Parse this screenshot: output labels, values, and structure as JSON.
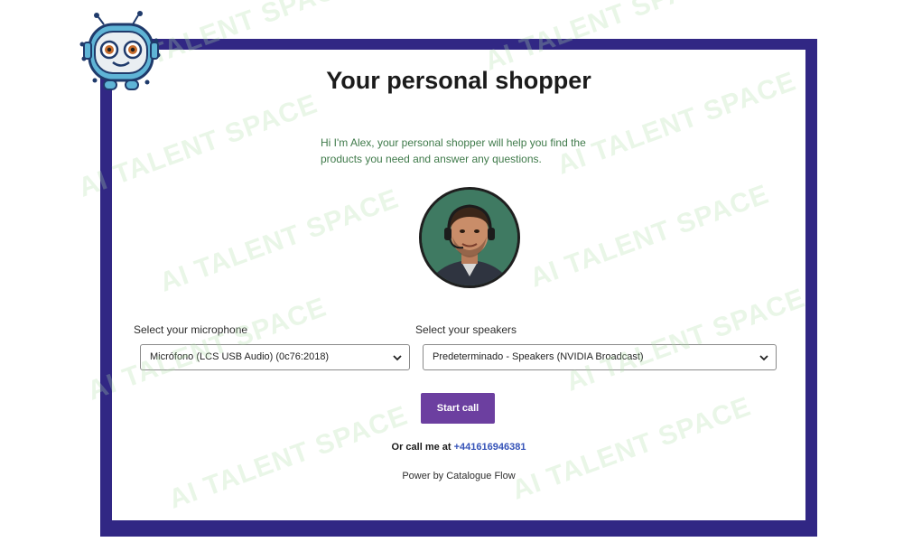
{
  "header": {
    "title": "Your personal shopper"
  },
  "intro": {
    "text": "Hi I'm Alex, your personal shopper will help you find the products you need and answer any questions."
  },
  "microphone": {
    "label": "Select your microphone",
    "selected": "Micrófono (LCS USB Audio) (0c76:2018)"
  },
  "speakers": {
    "label": "Select your speakers",
    "selected": "Predeterminado - Speakers (NVIDIA Broadcast)"
  },
  "call": {
    "start_label": "Start call"
  },
  "callme": {
    "prefix": "Or call me at",
    "phone": "+441616946381"
  },
  "footer": {
    "powered": "Power by Catalogue Flow"
  },
  "watermark": {
    "text": "AI TALENT SPACE"
  },
  "colors": {
    "frame": "#312784",
    "button": "#6c3fa0",
    "phone_link": "#3553b8",
    "intro_text": "#3f7a4a"
  },
  "icons": {
    "logo": "robot-logo-icon",
    "select_arrow": "chevron-down-icon"
  }
}
